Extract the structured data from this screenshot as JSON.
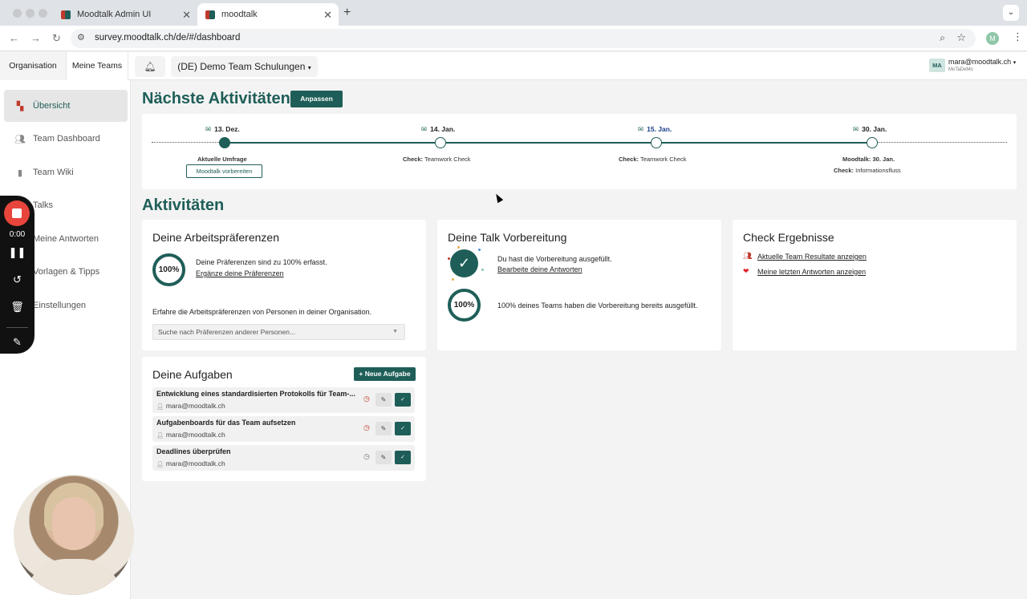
{
  "browser": {
    "tabs": [
      {
        "title": "Moodtalk Admin UI"
      },
      {
        "title": "moodtalk"
      }
    ],
    "url": "survey.moodtalk.ch/de/#/dashboard",
    "profile_initial": "M"
  },
  "topbar": {
    "segments": [
      "Organisation",
      "Meine Teams"
    ],
    "team_selector": "(DE) Demo Team Schulungen",
    "user": {
      "initials": "MA",
      "email": "mara@moodtalk.ch",
      "org": "MoTaDeMo"
    }
  },
  "sidebar": {
    "items": [
      {
        "label": "Übersicht",
        "icon": "overview-icon"
      },
      {
        "label": "Team Dashboard",
        "icon": "team-icon"
      },
      {
        "label": "Team Wiki",
        "icon": "wiki-icon"
      },
      {
        "label": "Talks",
        "icon": "talks-icon"
      },
      {
        "label": "Meine Antworten",
        "icon": "answers-icon"
      },
      {
        "label": "Vorlagen & Tipps",
        "icon": "templates-icon"
      },
      {
        "label": "Einstellungen",
        "icon": "settings-icon"
      }
    ]
  },
  "recorder": {
    "time": "0:00"
  },
  "next": {
    "title": "Nächste Aktivitäten",
    "customize": "Anpassen",
    "timeline": [
      {
        "date": "13. Dez.",
        "line1": "Aktuelle Umfrage",
        "button": "Moodtalk vorbereiten"
      },
      {
        "date": "14. Jan.",
        "line1_bold": "Check:",
        "line1": "Teamwork Check"
      },
      {
        "date": "15. Jan.",
        "line1_bold": "Check:",
        "line1": "Teamwork Check"
      },
      {
        "date": "30. Jan.",
        "line1_bold": "Moodtalk:",
        "line1": "30. Jan.",
        "line2_bold": "Check:",
        "line2": "Informationsfluss"
      }
    ]
  },
  "activities": {
    "title": "Aktivitäten",
    "prefs": {
      "title": "Deine Arbeitspräferenzen",
      "percent": "100%",
      "text": "Deine Präferenzen sind zu 100% erfasst.",
      "link": "Ergänze deine Präferenzen",
      "explore": "Erfahre die Arbeitspräferenzen von Personen in deiner Organisation.",
      "search_placeholder": "Suche nach Präferenzen anderer Personen..."
    },
    "talk": {
      "title": "Deine Talk Vorbereitung",
      "done_text": "Du hast die Vorbereitung ausgefüllt.",
      "edit_link": "Bearbeite deine Antworten",
      "team_percent": "100%",
      "team_text": "100% deines Teams haben die Vorbereitung bereits ausgefüllt."
    },
    "check": {
      "title": "Check Ergebnisse",
      "link1": "Aktuelle Team Resultate anzeigen",
      "link2": "Meine letzten Antworten anzeigen"
    }
  },
  "tasks": {
    "title": "Deine Aufgaben",
    "new_button": "Neue Aufgabe",
    "items": [
      {
        "title": "Entwicklung eines standardisierten Protokolls für Team-...",
        "user": "mara@moodtalk.ch"
      },
      {
        "title": "Aufgabenboards für das Team aufsetzen",
        "user": "mara@moodtalk.ch"
      },
      {
        "title": "Deadlines überprüfen",
        "user": "mara@moodtalk.ch"
      }
    ]
  },
  "colors": {
    "brand": "#1f5e58",
    "accent_red": "#c0392b",
    "date_blue": "#1a3f8a"
  }
}
